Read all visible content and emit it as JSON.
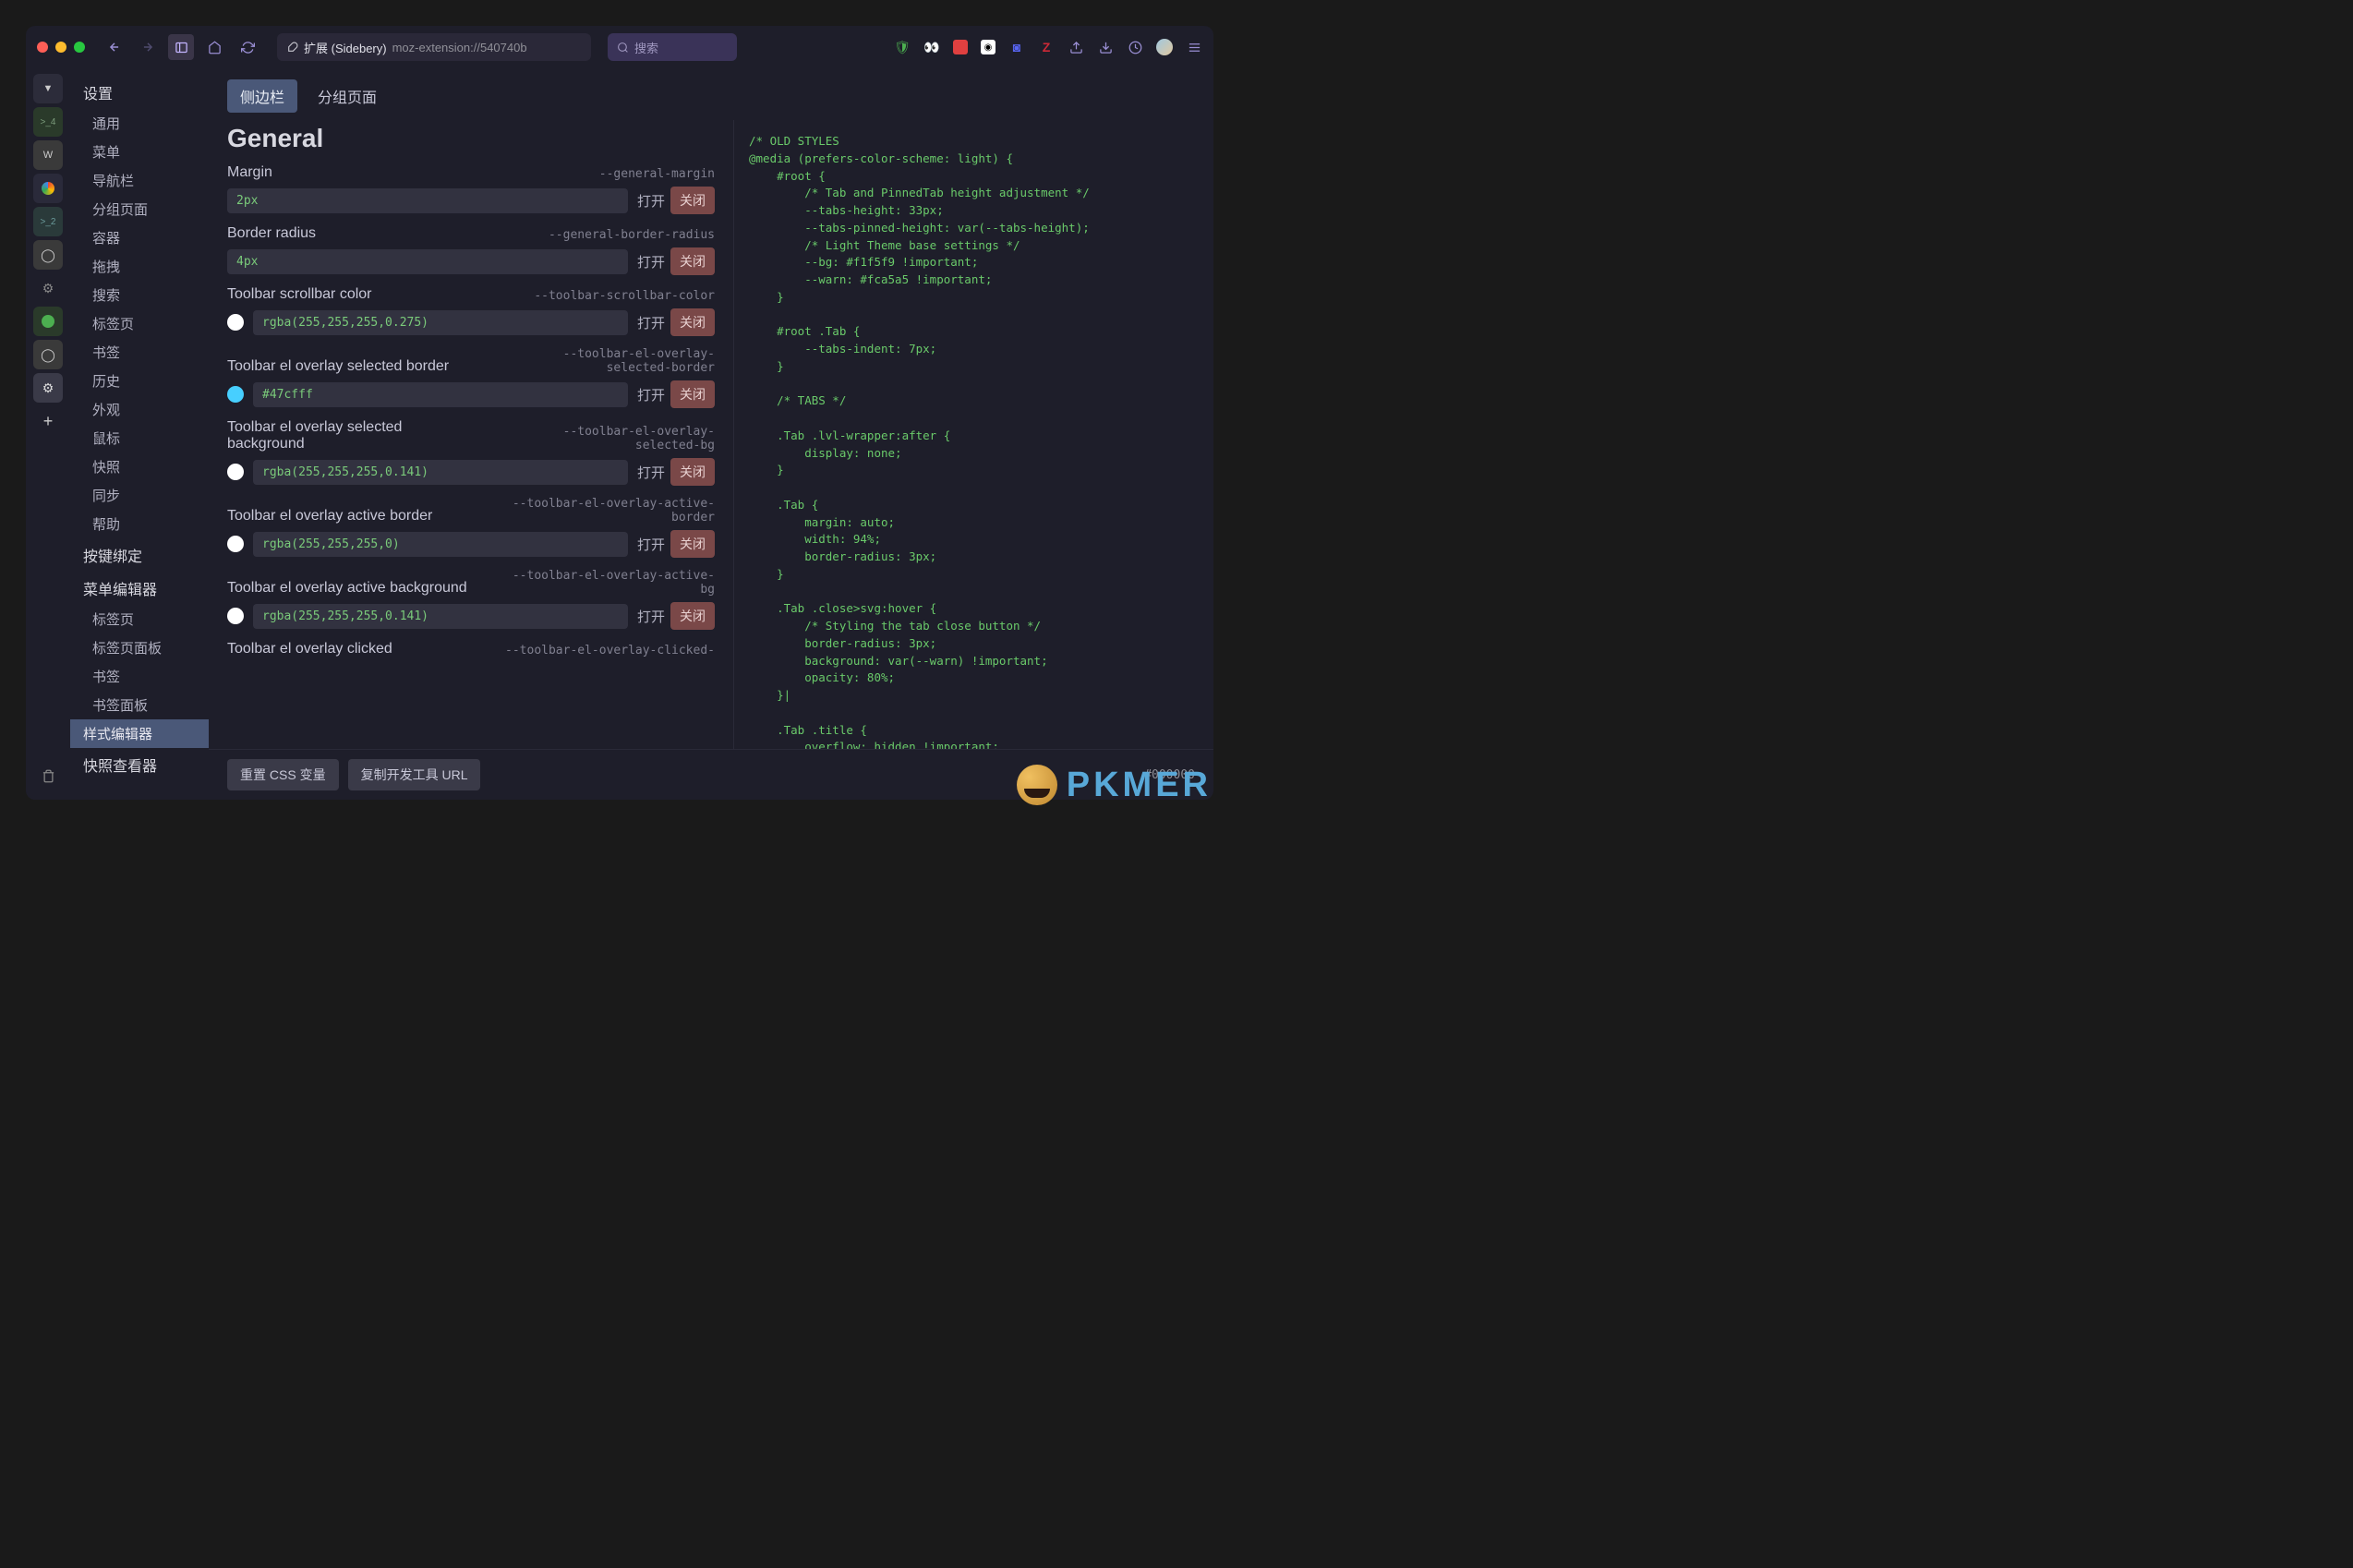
{
  "titlebar": {
    "ext_label": "扩展 (Sidebery)",
    "url": "moz-extension://540740b",
    "search_placeholder": "搜索"
  },
  "nav": {
    "settings": "设置",
    "items1": [
      "通用",
      "菜单",
      "导航栏",
      "分组页面",
      "容器",
      "拖拽",
      "搜索",
      "标签页",
      "书签",
      "历史",
      "外观",
      "鼠标",
      "快照",
      "同步",
      "帮助"
    ],
    "keybind": "按键绑定",
    "menu_editor": "菜单编辑器",
    "items2": [
      "标签页",
      "标签页面板",
      "书签",
      "书签面板"
    ],
    "style_editor": "样式编辑器",
    "snapshot_viewer": "快照查看器"
  },
  "tabs": {
    "sidebar": "侧边栏",
    "group": "分组页面"
  },
  "section_title": "General",
  "toggle": {
    "open": "打开",
    "close": "关闭"
  },
  "rows": [
    {
      "label": "Margin",
      "var": "--general-margin",
      "value": "2px",
      "swatch": null
    },
    {
      "label": "Border radius",
      "var": "--general-border-radius",
      "value": "4px",
      "swatch": null
    },
    {
      "label": "Toolbar scrollbar color",
      "var": "--toolbar-scrollbar-color",
      "value": "rgba(255,255,255,0.275)",
      "swatch": "#ffffff"
    },
    {
      "label": "Toolbar el overlay selected border",
      "var": "--toolbar-el-overlay-selected-border",
      "value": "#47cfff",
      "swatch": "#47cfff"
    },
    {
      "label": "Toolbar el overlay selected background",
      "var": "--toolbar-el-overlay-selected-bg",
      "value": "rgba(255,255,255,0.141)",
      "swatch": "#ffffff"
    },
    {
      "label": "Toolbar el overlay active border",
      "var": "--toolbar-el-overlay-active-border",
      "value": "rgba(255,255,255,0)",
      "swatch": "#ffffff"
    },
    {
      "label": "Toolbar el overlay active background",
      "var": "--toolbar-el-overlay-active-bg",
      "value": "rgba(255,255,255,0.141)",
      "swatch": "#ffffff"
    },
    {
      "label": "Toolbar el overlay clicked",
      "var": "--toolbar-el-overlay-clicked-",
      "value": "",
      "swatch": null
    }
  ],
  "footer": {
    "reset": "重置 CSS 变量",
    "copy": "复制开发工具 URL",
    "hex": "#000000"
  },
  "code": "/* OLD STYLES\n@media (prefers-color-scheme: light) {\n    #root {\n        /* Tab and PinnedTab height adjustment */\n        --tabs-height: 33px;\n        --tabs-pinned-height: var(--tabs-height);\n        /* Light Theme base settings */\n        --bg: #f1f5f9 !important;\n        --warn: #fca5a5 !important;\n    }\n\n    #root .Tab {\n        --tabs-indent: 7px;\n    }\n\n    /* TABS */\n\n    .Tab .lvl-wrapper:after {\n        display: none;\n    }\n\n    .Tab {\n        margin: auto;\n        width: 94%;\n        border-radius: 3px;\n    }\n\n    .Tab .close>svg:hover {\n        /* Styling the tab close button */\n        border-radius: 3px;\n        background: var(--warn) !important;\n        opacity: 80%;\n    }|\n\n    .Tab .title {\n        overflow: hidden !important;\n    }\n\n    /* PINNED TABS */\n\n    .PinnedDock {\n        background-color: var(--bg) !important;\n    }\n\n    .PinnedTab {\n        margin: 5px 0px 4px 6px;\n        border-radius: 3px;\n    }",
  "watermark": "PKMER"
}
